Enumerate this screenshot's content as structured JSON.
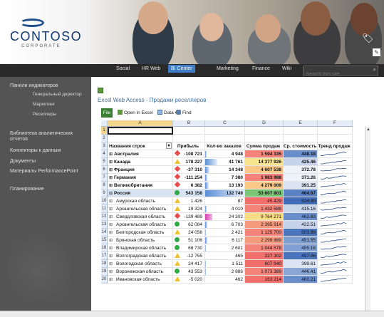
{
  "logo": {
    "name": "CONTOSO",
    "subtitle": "CORPORATE"
  },
  "nav": {
    "items": [
      "Social",
      "HR Web",
      "BI Center",
      "Marketing",
      "Finance",
      "Wiki"
    ],
    "active": "BI Center",
    "search_placeholder": "Search this site..."
  },
  "sidebar": {
    "items": [
      {
        "label": "Панели индикаторов",
        "sub": false
      },
      {
        "label": "Генеральный директор",
        "sub": true
      },
      {
        "label": "Маркетинг",
        "sub": true
      },
      {
        "label": "Реселлеры",
        "sub": true
      },
      {
        "label": "Библиотека аналитических отчетов",
        "sub": false
      },
      {
        "label": "Коннекторы к данным",
        "sub": false
      },
      {
        "label": "Документы",
        "sub": false
      },
      {
        "label": "Материалы PerformancePoint",
        "sub": false
      },
      {
        "label": "Планирование",
        "sub": false
      }
    ]
  },
  "main": {
    "title": "Excel Web Access - Продажи реселлеров",
    "toolbar": {
      "file": "File",
      "open": "Open in Excel",
      "data": "Data",
      "find": "Find"
    }
  },
  "grid": {
    "columns": [
      "A",
      "B",
      "C",
      "D",
      "E",
      "F"
    ],
    "headers": [
      "Названия строк",
      "Прибыль",
      "Кол-во заказов",
      "Сумма продаж",
      "Ср. стоимость",
      "Тренд продаж"
    ],
    "rows": [
      {
        "n": "4",
        "name": "Австралия",
        "bold": true,
        "exp": "+",
        "profit": "-108 721",
        "ind": "dn",
        "orders": "4 948",
        "ordBar": 0.04,
        "sales": "1 594 335",
        "salesColor": "#f4837a",
        "avg": "448.18",
        "avgColor": "#6a8ec9"
      },
      {
        "n": "5",
        "name": "Канада",
        "bold": true,
        "exp": "+",
        "profit": "178 227",
        "ind": "up",
        "orders": "41 761",
        "ordBar": 0.32,
        "sales": "14 377 926",
        "salesColor": "#f6e58c",
        "avg": "425.46",
        "avgColor": "#c6d3ea"
      },
      {
        "n": "6",
        "name": "Франция",
        "bold": true,
        "exp": "+",
        "profit": "-37 310",
        "ind": "dn",
        "orders": "14 348",
        "ordBar": 0.11,
        "sales": "4 607 538",
        "salesColor": "#fbc987",
        "avg": "372.78",
        "avgColor": "#eef2f9"
      },
      {
        "n": "7",
        "name": "Германия",
        "bold": true,
        "exp": "+",
        "profit": "-111 254",
        "ind": "dn",
        "orders": "7 380",
        "ordBar": 0.06,
        "sales": "1 983 988",
        "salesColor": "#f4837a",
        "avg": "371.26",
        "avgColor": "#eef2f9"
      },
      {
        "n": "8",
        "name": "Великобритания",
        "bold": true,
        "exp": "+",
        "profit": "6 382",
        "ind": "dn",
        "orders": "13 193",
        "ordBar": 0.1,
        "sales": "4 279 009",
        "salesColor": "#fbc987",
        "avg": "391.25",
        "avgColor": "#dbe4f2"
      },
      {
        "n": "9",
        "name": "Россия",
        "bold": true,
        "exp": "−",
        "profit": "543 158",
        "ind": "ok",
        "orders": "132 748",
        "ordBar": 1.0,
        "sales": "53 607 801",
        "salesColor": "#7cc576",
        "avg": "464.67",
        "avgColor": "#5b83c4",
        "highlight": true
      },
      {
        "n": "10",
        "name": "Амурская область",
        "bold": false,
        "exp": "+",
        "profit": "1 426",
        "ind": "up",
        "orders": "87",
        "ordBar": 0.0,
        "sales": "45 429",
        "salesColor": "#f2706c",
        "avg": "524.89",
        "avgColor": "#3f6bb6"
      },
      {
        "n": "11",
        "name": "Архангельская область",
        "bold": false,
        "exp": "+",
        "profit": "19 324",
        "ind": "up",
        "orders": "4 010",
        "ordBar": 0.03,
        "sales": "1 432 586",
        "salesColor": "#f4837a",
        "avg": "415.16",
        "avgColor": "#c8d5ea"
      },
      {
        "n": "12",
        "name": "Свердловская область",
        "bold": false,
        "exp": "+",
        "profit": "-139 489",
        "ind": "dn",
        "orders": "24 302",
        "ordBar": 0.19,
        "sales": "9 764 271",
        "salesColor": "#f9dc86",
        "avg": "462.83",
        "avgColor": "#6a8ec9",
        "ordPink": true
      },
      {
        "n": "13",
        "name": "Архангельская область",
        "bold": false,
        "exp": "+",
        "profit": "62 084",
        "ind": "ok",
        "orders": "6 703",
        "ordBar": 0.05,
        "sales": "2 395 914",
        "salesColor": "#f69a7d",
        "avg": "422.51",
        "avgColor": "#c6d3ea"
      },
      {
        "n": "14",
        "name": "Белгородская область",
        "bold": false,
        "exp": "+",
        "profit": "24 056",
        "ind": "up",
        "orders": "2 421",
        "ordBar": 0.02,
        "sales": "1 125 700",
        "salesColor": "#f4837a",
        "avg": "503.99",
        "avgColor": "#4a74bb"
      },
      {
        "n": "15",
        "name": "Брянская область",
        "bold": false,
        "exp": "+",
        "profit": "51 106",
        "ind": "ok",
        "orders": "6 117",
        "ordBar": 0.05,
        "sales": "2 299 889",
        "salesColor": "#f69a7d",
        "avg": "451.55",
        "avgColor": "#7f9ed1"
      },
      {
        "n": "16",
        "name": "Владимирская область",
        "bold": false,
        "exp": "+",
        "profit": "68 730",
        "ind": "ok",
        "orders": "2 601",
        "ordBar": 0.02,
        "sales": "1 044 578",
        "salesColor": "#f4837a",
        "avg": "455.16",
        "avgColor": "#7f9ed1"
      },
      {
        "n": "17",
        "name": "Волгоградская область",
        "bold": false,
        "exp": "+",
        "profit": "-12 755",
        "ind": "up",
        "orders": "465",
        "ordBar": 0.0,
        "sales": "227 302",
        "salesColor": "#f2706c",
        "avg": "497.06",
        "avgColor": "#4a74bb"
      },
      {
        "n": "18",
        "name": "Вологодская область",
        "bold": false,
        "exp": "+",
        "profit": "24 417",
        "ind": "up",
        "orders": "1 511",
        "ordBar": 0.01,
        "sales": "607 940",
        "salesColor": "#f2706c",
        "avg": "399.61",
        "avgColor": "#dbe4f2"
      },
      {
        "n": "19",
        "name": "Воронежская область",
        "bold": false,
        "exp": "+",
        "profit": "43 553",
        "ind": "ok",
        "orders": "2 886",
        "ordBar": 0.02,
        "sales": "1 073 389",
        "salesColor": "#f4837a",
        "avg": "446.41",
        "avgColor": "#8aa6d4"
      },
      {
        "n": "20",
        "name": "Ивановская область",
        "bold": false,
        "exp": "+",
        "profit": "-5 020",
        "ind": "up",
        "orders": "462",
        "ordBar": 0.0,
        "sales": "163 214",
        "salesColor": "#f2706c",
        "avg": "460.21",
        "avgColor": "#6a8ec9"
      }
    ]
  }
}
